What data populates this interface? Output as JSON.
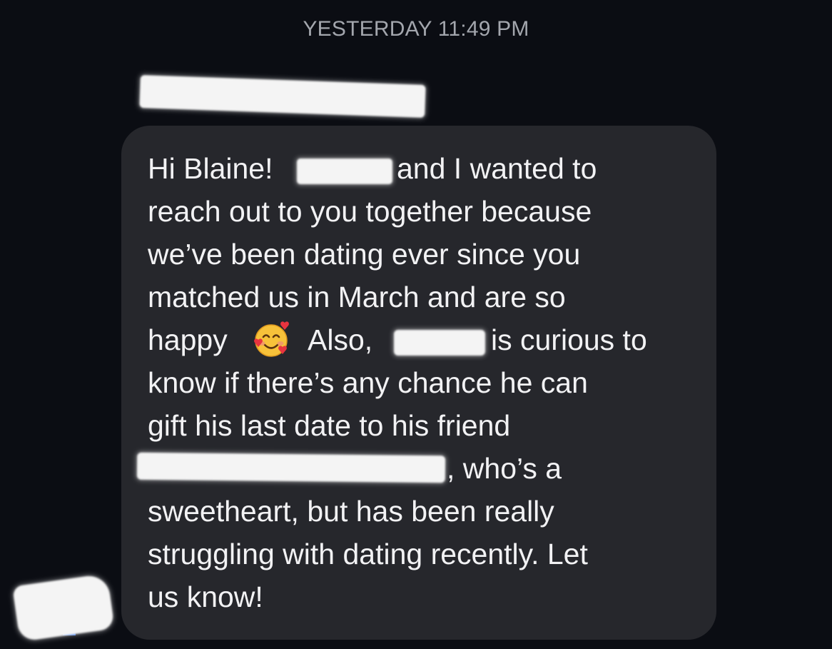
{
  "conversation": {
    "timestamp": "YESTERDAY 11:49 PM"
  },
  "message": {
    "sender_redacted": true,
    "emoji": "smiling-face-with-hearts",
    "lines": [
      {
        "before": "Hi Blaine! ",
        "after": "and I wanted to"
      },
      {
        "text": "reach out to you together because"
      },
      {
        "text": "we’ve been dating ever since you"
      },
      {
        "text": "matched us in March and are so"
      },
      {
        "before": "happy ",
        "middle": "Also,",
        "after": "is curious to"
      },
      {
        "text": "know if there’s any chance he can"
      },
      {
        "text": "gift his last date to his friend"
      },
      {
        "after": ", who’s a"
      },
      {
        "text": "sweetheart, but has been really"
      },
      {
        "text": "struggling with dating recently. Let"
      },
      {
        "text": "us know!"
      }
    ]
  },
  "colors": {
    "background": "#0b0d13",
    "bubble": "#26272c",
    "text": "#f2f2f4",
    "timestamp": "#a3a6ad",
    "redaction": "#f4f4f4"
  }
}
